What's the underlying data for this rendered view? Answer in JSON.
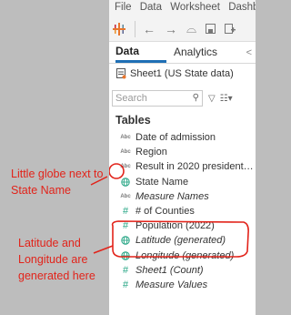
{
  "annotations": {
    "globe_note": "Little globe next to State Name",
    "latlon_note": "Latitude and Longitude are generated here"
  },
  "menubar": [
    "File",
    "Data",
    "Worksheet",
    "Dashbo"
  ],
  "toolbar": {
    "icons": [
      "tableau-logo-icon",
      "back-arrow-icon",
      "forward-arrow-icon",
      "connect-icon",
      "save-icon",
      "new-datasource-icon"
    ]
  },
  "tabs": {
    "data": "Data",
    "analytics": "Analytics",
    "collapse": "<"
  },
  "datasource": {
    "label": "Sheet1 (US State data)"
  },
  "search": {
    "placeholder": "Search"
  },
  "tables_header": "Tables",
  "fields": [
    {
      "name": "Date of admission",
      "type": "abc",
      "italic": false
    },
    {
      "name": "Region",
      "type": "abc",
      "italic": false
    },
    {
      "name": "Result in 2020 presidential ...",
      "type": "abc",
      "italic": false
    },
    {
      "name": "State Name",
      "type": "geo",
      "italic": false
    },
    {
      "name": "Measure Names",
      "type": "abc",
      "italic": true
    },
    {
      "name": "# of Counties",
      "type": "measure",
      "italic": false
    },
    {
      "name": "Population (2022)",
      "type": "measure",
      "italic": false
    },
    {
      "name": "Latitude (generated)",
      "type": "geo",
      "italic": true
    },
    {
      "name": "Longitude (generated)",
      "type": "geo",
      "italic": true
    },
    {
      "name": "Sheet1 (Count)",
      "type": "measure",
      "italic": true
    },
    {
      "name": "Measure Values",
      "type": "measure",
      "italic": true
    }
  ],
  "abc_glyph": "Abc",
  "colors": {
    "annotation_red": "#e2231a",
    "tab_accent": "#1f6fb5",
    "field_green": "#25a584"
  }
}
